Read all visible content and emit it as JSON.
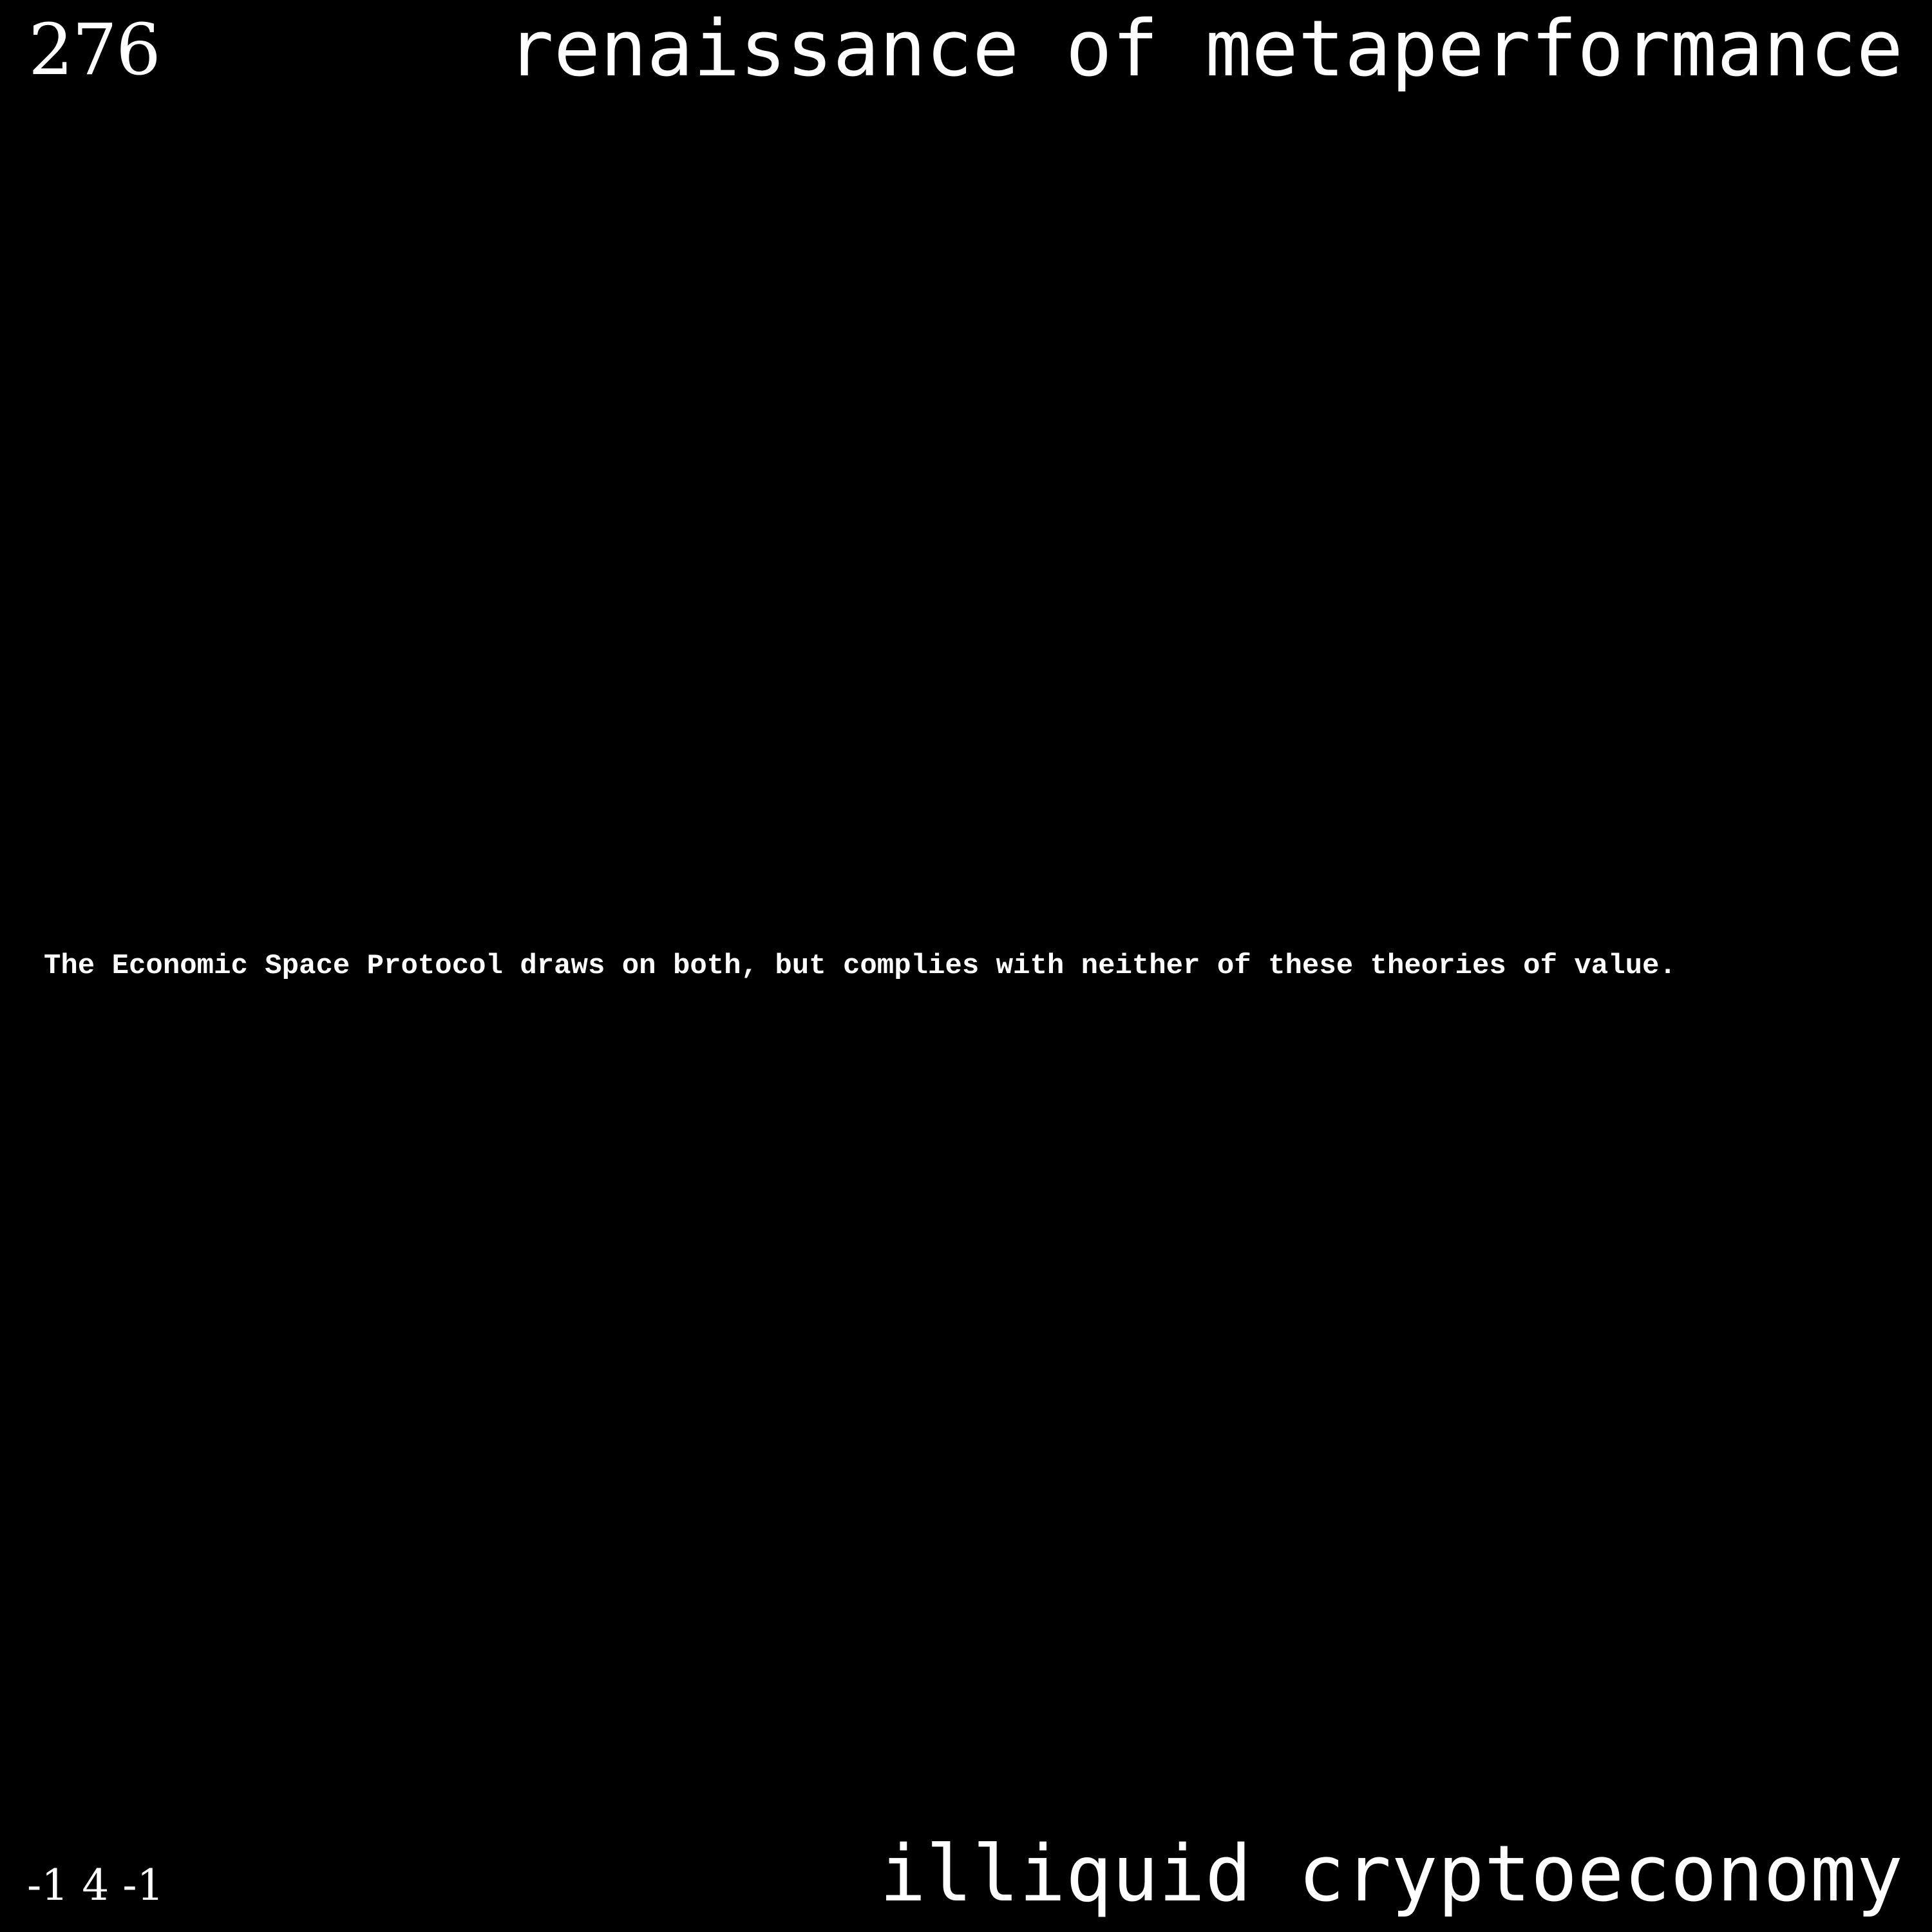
{
  "header": {
    "number": "276",
    "title": "renaissance of metaperformance"
  },
  "main": {
    "text": "The Economic Space Protocol draws on both, but complies with neither of these theories of value."
  },
  "footer": {
    "coordinates": "-1 4 -1",
    "subtitle": "illiquid cryptoeconomy"
  },
  "colors": {
    "background": "#000000",
    "text": "#ffffff"
  }
}
